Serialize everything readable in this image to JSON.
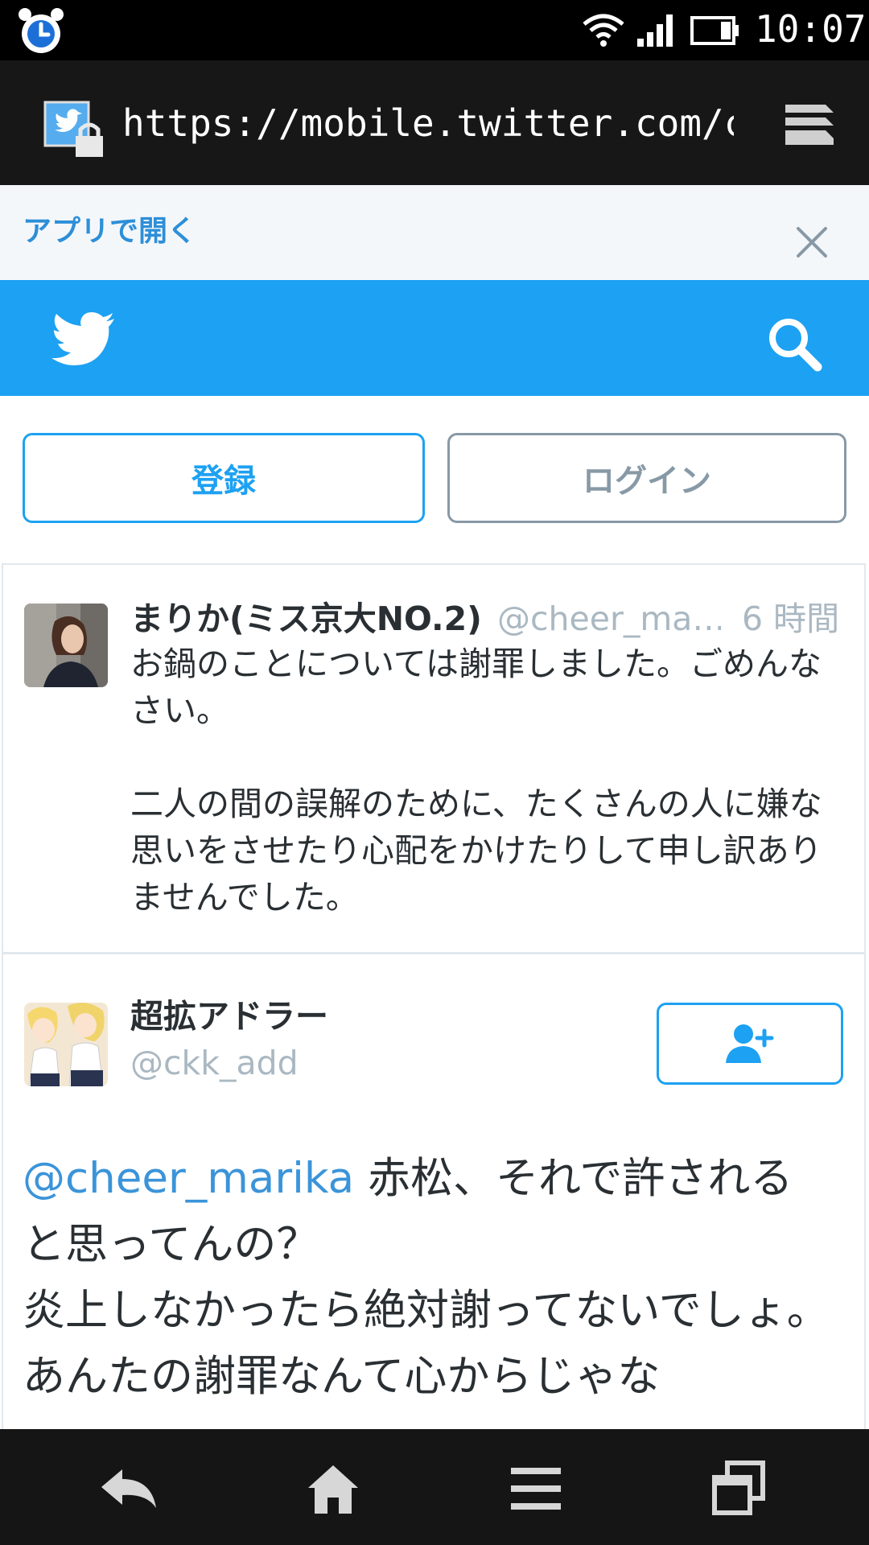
{
  "status_bar": {
    "time": "10:07",
    "icons": [
      "alarm-clock-icon",
      "wifi-icon",
      "signal-icon",
      "battery-icon"
    ]
  },
  "browser": {
    "url": "https://mobile.twitter.com/c",
    "icons": [
      "twitter-favicon-icon",
      "lock-icon",
      "window-stack-icon"
    ]
  },
  "app_banner": {
    "open_in_app": "アプリで開く",
    "close_icon": "close-icon"
  },
  "header": {
    "brand_color": "#1da1f2",
    "icons": [
      "twitter-bird-icon",
      "search-icon"
    ]
  },
  "auth": {
    "signup_label": "登録",
    "login_label": "ログイン"
  },
  "tweets": [
    {
      "name": "まりか(ミス京大NO.2)",
      "handle": "@cheer_ma…",
      "time": "6 時間",
      "text": "お鍋のことについては謝罪しました。ごめんなさい。\n\n二人の間の誤解のために、たくさんの人に嫌な思いをさせたり心配をかけたりして申し訳ありませんでした。"
    },
    {
      "name": "超拡アドラー",
      "handle": "@ckk_add",
      "follow_icon": "add-user-icon",
      "mention": "@cheer_marika",
      "text": " 赤松、それで許されると思ってんの？\n炎上しなかったら絶対謝ってないでしょ。あんたの謝罪なんて心からじゃな"
    }
  ],
  "bottom_nav": {
    "icons": [
      "back-arrow-icon",
      "home-icon",
      "menu-icon",
      "windows-icon"
    ]
  }
}
